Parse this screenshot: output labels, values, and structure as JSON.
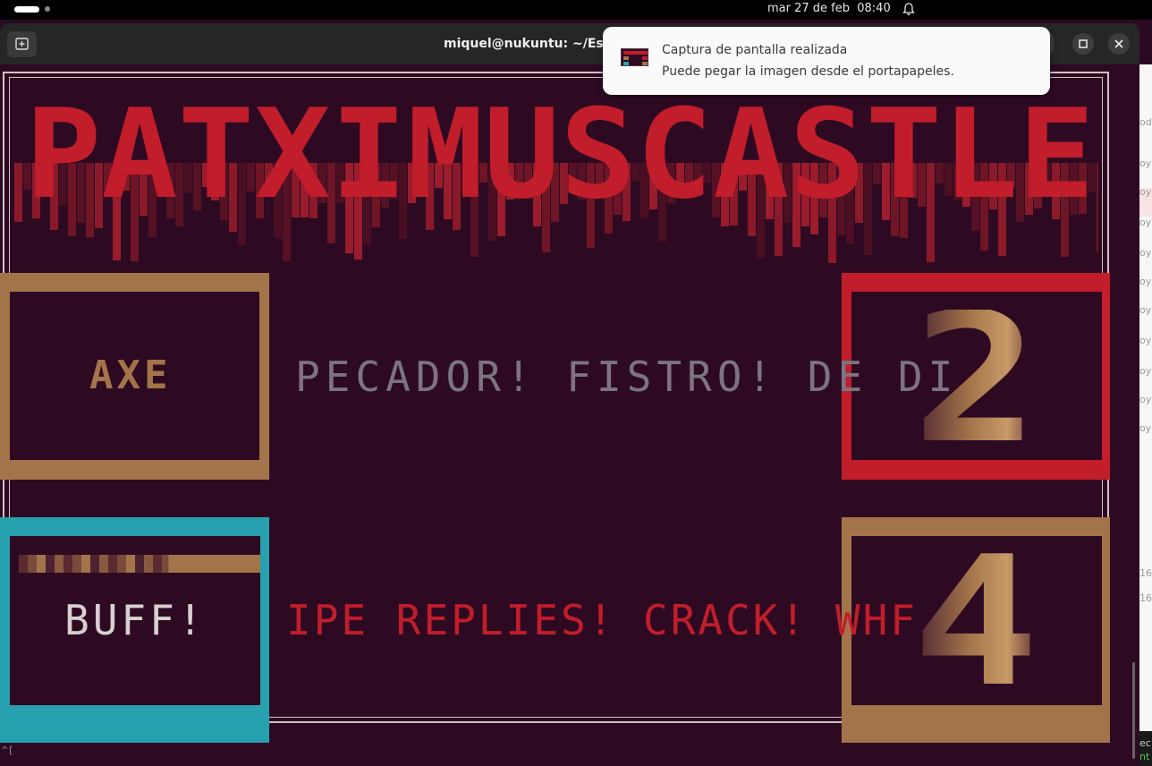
{
  "system_bar": {
    "clock": "mar 27 de feb  08:40"
  },
  "window": {
    "title": "miquel@nukuntu: ~/Escrit"
  },
  "notification": {
    "title": "Captura de pantalla realizada",
    "body": "Puede pegar la imagen desde el portapapeles."
  },
  "game": {
    "title": "PATXIMUSCASTLE",
    "weapon": "AXE",
    "message_top": "PECADOR! FISTRO! DE DI",
    "buff": "BUFF!",
    "message_bottom": "IPE REPLIES! CRACK! WHF",
    "level": "2",
    "lives": "4",
    "energy": 0.62,
    "colors": {
      "background": "#2d0a22",
      "title_red": "#c21d2b",
      "brown": "#a3744a",
      "cyan": "#27a0b0",
      "grey_text": "#7c7480"
    }
  },
  "right_window_fragments": [
    "odi",
    "oy",
    "oy",
    "oy",
    "oy",
    "oy",
    "oy",
    "oy",
    "oy",
    "oy",
    "oy",
    "16",
    "16",
    "ec",
    "nt"
  ],
  "terminal_prompt": "^["
}
